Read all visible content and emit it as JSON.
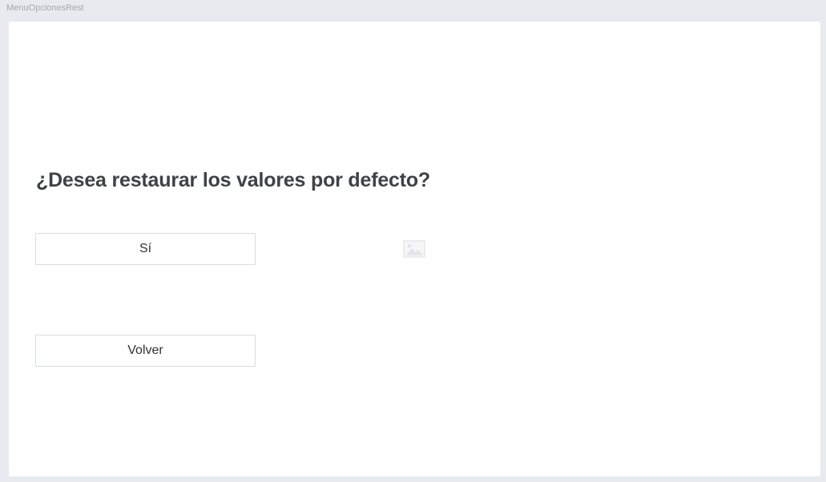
{
  "frame": {
    "label": "MenuOpcionesRest"
  },
  "dialog": {
    "title": "¿Desea restaurar los valores por defecto?",
    "yes_label": "Sí",
    "back_label": "Volver"
  },
  "icons": {
    "placeholder": "image-placeholder-icon"
  },
  "colors": {
    "background": "#e7ebef",
    "surface": "#ffffff",
    "title_text": "#3f4245",
    "button_border": "#d9dde1"
  }
}
